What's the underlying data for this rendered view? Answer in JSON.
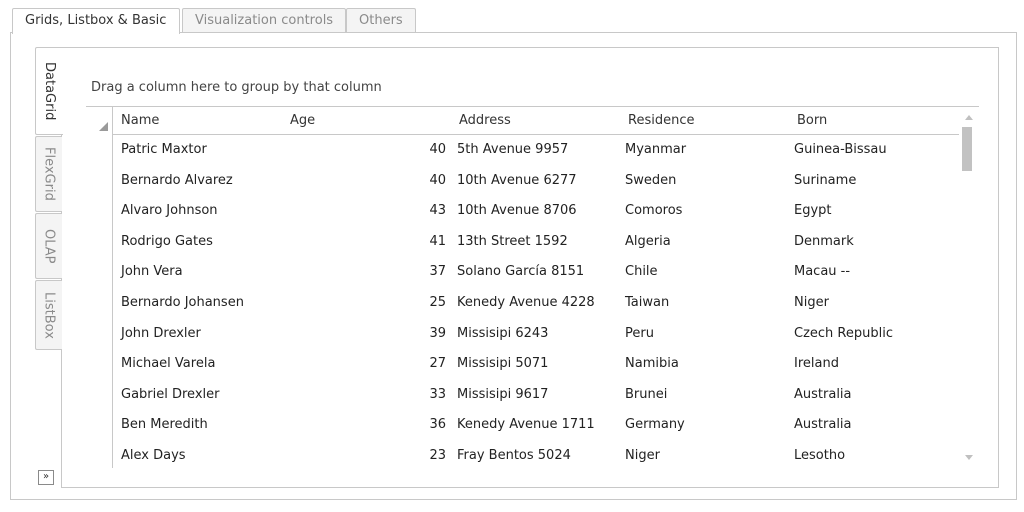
{
  "top_tabs": [
    "Grids, Listbox & Basic",
    "Visualization controls",
    "Others"
  ],
  "side_tabs": [
    "DataGrid",
    "FlexGrid",
    "OLAP",
    "ListBox"
  ],
  "group_hint": "Drag a column here to group by that column",
  "collapse_glyph": "»",
  "grid": {
    "columns": [
      "Name",
      "Age",
      "Address",
      "Residence",
      "Born"
    ],
    "rows": [
      [
        "Patric Maxtor",
        "40",
        "5th Avenue 9957",
        "Myanmar",
        "Guinea-Bissau"
      ],
      [
        "Bernardo Alvarez",
        "40",
        "10th Avenue 6277",
        "Sweden",
        "Suriname"
      ],
      [
        "Alvaro Johnson",
        "43",
        "10th Avenue 8706",
        "Comoros",
        "Egypt"
      ],
      [
        "Rodrigo Gates",
        "41",
        "13th Street 1592",
        "Algeria",
        "Denmark"
      ],
      [
        "John Vera",
        "37",
        "Solano García 8151",
        "Chile",
        "Macau --"
      ],
      [
        "Bernardo Johansen",
        "25",
        "Kenedy Avenue 4228",
        "Taiwan",
        "Niger"
      ],
      [
        "John Drexler",
        "39",
        "Missisipi 6243",
        "Peru",
        "Czech Republic"
      ],
      [
        "Michael Varela",
        "27",
        "Missisipi 5071",
        "Namibia",
        "Ireland"
      ],
      [
        "Gabriel Drexler",
        "33",
        "Missisipi 9617",
        "Brunei",
        "Australia"
      ],
      [
        "Ben Meredith",
        "36",
        "Kenedy Avenue 1711",
        "Germany",
        "Australia"
      ],
      [
        "Alex Days",
        "23",
        "Fray Bentos 5024",
        "Niger",
        "Lesotho"
      ]
    ]
  }
}
